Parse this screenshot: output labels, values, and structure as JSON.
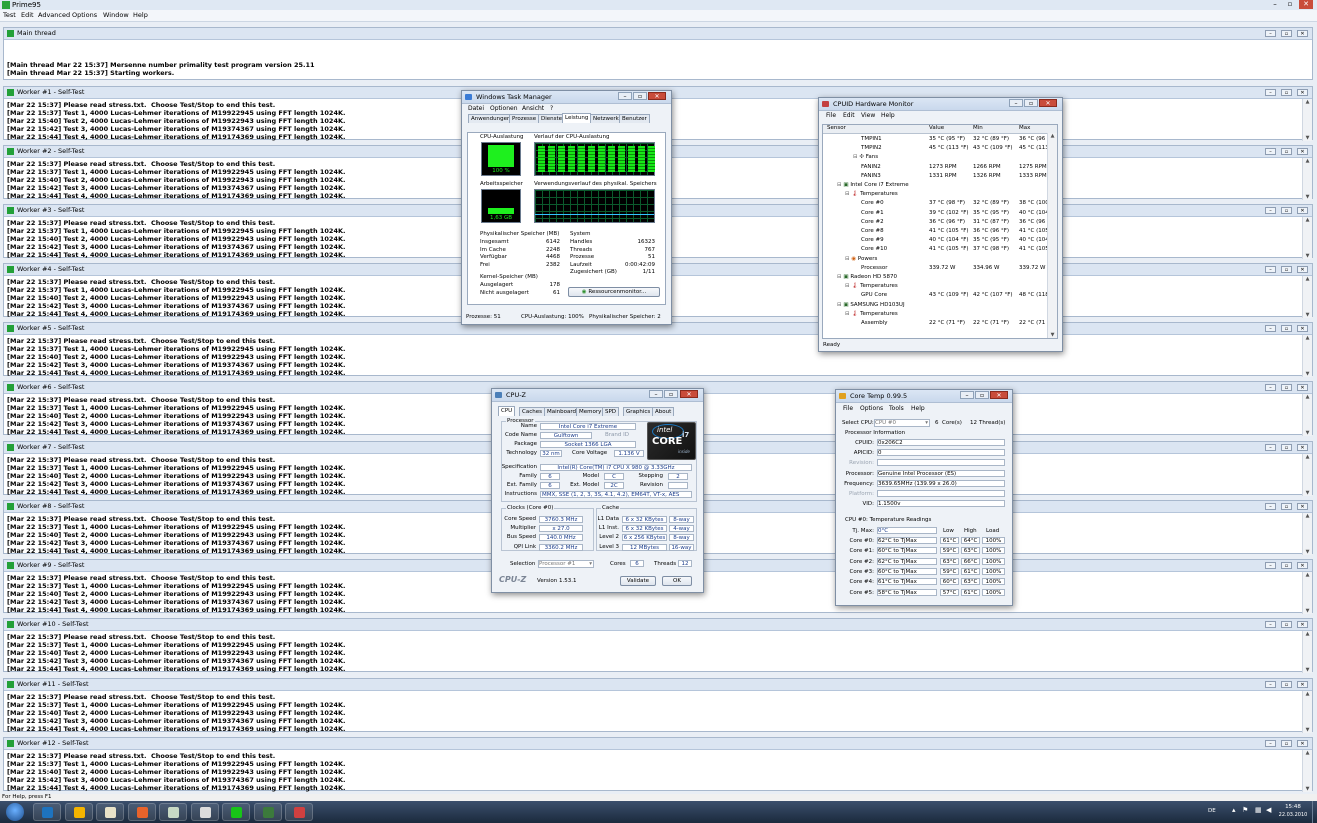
{
  "app": {
    "title": "Prime95",
    "menu": [
      "Test",
      "Edit",
      "Advanced",
      "Options",
      "Window",
      "Help"
    ],
    "status": "For Help, press F1"
  },
  "main_thread": {
    "title": "Main thread",
    "lines": [
      "[Main thread Mar 22 15:37] Mersenne number primality test program version 25.11",
      "[Main thread Mar 22 15:37] Starting workers."
    ]
  },
  "workers": [
    {
      "title": "Worker #1 - Self-Test"
    },
    {
      "title": "Worker #2 - Self-Test"
    },
    {
      "title": "Worker #3 - Self-Test"
    },
    {
      "title": "Worker #4 - Self-Test"
    },
    {
      "title": "Worker #5 - Self-Test"
    },
    {
      "title": "Worker #6 - Self-Test"
    },
    {
      "title": "Worker #7 - Self-Test"
    },
    {
      "title": "Worker #8 - Self-Test"
    },
    {
      "title": "Worker #9 - Self-Test"
    },
    {
      "title": "Worker #10 - Self-Test"
    },
    {
      "title": "Worker #11 - Self-Test"
    },
    {
      "title": "Worker #12 - Self-Test"
    }
  ],
  "worker_lines": [
    "[Mar 22 15:37] Please read stress.txt.  Choose Test/Stop to end this test.",
    "[Mar 22 15:37] Test 1, 4000 Lucas-Lehmer iterations of M19922945 using FFT length 1024K.",
    "[Mar 22 15:40] Test 2, 4000 Lucas-Lehmer iterations of M19922943 using FFT length 1024K.",
    "[Mar 22 15:42] Test 3, 4000 Lucas-Lehmer iterations of M19374367 using FFT length 1024K.",
    "[Mar 22 15:44] Test 4, 4000 Lucas-Lehmer iterations of M19174369 using FFT length 1024K."
  ],
  "taskmgr": {
    "title": "Windows Task Manager",
    "menu": [
      "Datei",
      "Optionen",
      "Ansicht",
      "?"
    ],
    "tabs": [
      "Anwendungen",
      "Prozesse",
      "Dienste",
      "Leistung",
      "Netzwerk",
      "Benutzer"
    ],
    "cpu_label": "CPU-Auslastung",
    "cpu_value": "100 %",
    "cpu_history_label": "Verlauf der CPU-Auslastung",
    "mem_label": "Arbeitsspeicher",
    "mem_value": "1,63 GB",
    "mem_history_label": "Verwendungsverlauf des physikal. Speichers",
    "phys_title": "Physikalischer Speicher (MB)",
    "phys": [
      [
        "Insgesamt",
        "6142"
      ],
      [
        "Im Cache",
        "2248"
      ],
      [
        "Verfügbar",
        "4468"
      ],
      [
        "Frei",
        "2382"
      ]
    ],
    "kernel_title": "Kernel-Speicher (MB)",
    "kernel": [
      [
        "Ausgelagert",
        "178"
      ],
      [
        "Nicht ausgelagert",
        "61"
      ]
    ],
    "system_title": "System",
    "system": [
      [
        "Handles",
        "16323"
      ],
      [
        "Threads",
        "767"
      ],
      [
        "Prozesse",
        "51"
      ],
      [
        "Laufzeit",
        "0:00:42:09"
      ],
      [
        "Zugesichert (GB)",
        "1/11"
      ]
    ],
    "resmon_button": "Ressourcenmonitor...",
    "status": [
      "Prozesse: 51",
      "CPU-Auslastung: 100%",
      "Physikalischer Speicher: 2"
    ],
    "cpu_usage_fraction": 1.0
  },
  "cpuid": {
    "title": "CPUID Hardware Monitor",
    "menu": [
      "File",
      "Edit",
      "View",
      "Help"
    ],
    "columns": [
      "Sensor",
      "Value",
      "Min",
      "Max"
    ],
    "rows": [
      {
        "indent": 4,
        "name": "TMPIN1",
        "value": "35 °C (95 °F)",
        "min": "32 °C (89 °F)",
        "max": "36 °C (96 °F"
      },
      {
        "indent": 4,
        "name": "TMPIN2",
        "value": "45 °C (113 °F)",
        "min": "43 °C (109 °F)",
        "max": "45 °C (113 °"
      },
      {
        "indent": 3,
        "name": "Fans",
        "value": "",
        "min": "",
        "max": ""
      },
      {
        "indent": 4,
        "name": "FANIN2",
        "value": "1273 RPM",
        "min": "1266 RPM",
        "max": "1275 RPM"
      },
      {
        "indent": 4,
        "name": "FANIN3",
        "value": "1331 RPM",
        "min": "1326 RPM",
        "max": "1333 RPM"
      },
      {
        "indent": 1,
        "name": "Intel Core i7 Extreme",
        "value": "",
        "min": "",
        "max": ""
      },
      {
        "indent": 2,
        "name": "Temperatures",
        "value": "",
        "min": "",
        "max": ""
      },
      {
        "indent": 4,
        "name": "Core #0",
        "value": "37 °C (98 °F)",
        "min": "32 °C (89 °F)",
        "max": "38 °C (100 °"
      },
      {
        "indent": 4,
        "name": "Core #1",
        "value": "39 °C (102 °F)",
        "min": "35 °C (95 °F)",
        "max": "40 °C (104 °"
      },
      {
        "indent": 4,
        "name": "Core #2",
        "value": "36 °C (96 °F)",
        "min": "31 °C (87 °F)",
        "max": "36 °C (96 °F"
      },
      {
        "indent": 4,
        "name": "Core #8",
        "value": "41 °C (105 °F)",
        "min": "36 °C (96 °F)",
        "max": "41 °C (105 °"
      },
      {
        "indent": 4,
        "name": "Core #9",
        "value": "40 °C (104 °F)",
        "min": "35 °C (95 °F)",
        "max": "40 °C (104 °"
      },
      {
        "indent": 4,
        "name": "Core #10",
        "value": "41 °C (105 °F)",
        "min": "37 °C (98 °F)",
        "max": "41 °C (105 °"
      },
      {
        "indent": 2,
        "name": "Powers",
        "value": "",
        "min": "",
        "max": ""
      },
      {
        "indent": 4,
        "name": "Processor",
        "value": "339.72 W",
        "min": "334.96 W",
        "max": "339.72 W"
      },
      {
        "indent": 1,
        "name": "Radeon HD 5870",
        "value": "",
        "min": "",
        "max": ""
      },
      {
        "indent": 2,
        "name": "Temperatures",
        "value": "",
        "min": "",
        "max": ""
      },
      {
        "indent": 4,
        "name": "GPU Core",
        "value": "43 °C (109 °F)",
        "min": "42 °C (107 °F)",
        "max": "48 °C (118 °"
      },
      {
        "indent": 1,
        "name": "SAMSUNG HD103UJ",
        "value": "",
        "min": "",
        "max": ""
      },
      {
        "indent": 2,
        "name": "Temperatures",
        "value": "",
        "min": "",
        "max": ""
      },
      {
        "indent": 4,
        "name": "Assembly",
        "value": "22 °C (71 °F)",
        "min": "22 °C (71 °F)",
        "max": "22 °C (71 °"
      }
    ],
    "status": "Ready"
  },
  "cpuz": {
    "title": "CPU-Z",
    "tabs": [
      "CPU",
      "Caches",
      "Mainboard",
      "Memory",
      "SPD",
      "Graphics",
      "About"
    ],
    "processor_group": "Processor",
    "name_label": "Name",
    "name": "Intel Core i7 Extreme",
    "codename_label": "Code Name",
    "codename": "Gulftown",
    "brandid_label": "Brand ID",
    "package_label": "Package",
    "package": "Socket 1366 LGA",
    "technology_label": "Technology",
    "technology": "32 nm",
    "corevoltage_label": "Core Voltage",
    "corevoltage": "1.136 V",
    "spec_label": "Specification",
    "spec": "Intel(R) Core(TM) i7 CPU    X 980  @ 3.33GHz",
    "family_label": "Family",
    "family": "6",
    "model_label": "Model",
    "model": "C",
    "stepping_label": "Stepping",
    "stepping": "2",
    "extfamily_label": "Ext. Family",
    "extfamily": "6",
    "extmodel_label": "Ext. Model",
    "extmodel": "2C",
    "revision_label": "Revision",
    "revision": "",
    "instructions_label": "Instructions",
    "instructions": "MMX, SSE (1, 2, 3, 3S, 4.1, 4.2), EM64T, VT-x, AES",
    "clocks_group": "Clocks (Core #0)",
    "clocks": [
      [
        "Core Speed",
        "3760.3 MHz"
      ],
      [
        "Multiplier",
        "x 27.0"
      ],
      [
        "Bus Speed",
        "140.0 MHz"
      ],
      [
        "QPI Link",
        "3360.2 MHz"
      ]
    ],
    "cache_group": "Cache",
    "cache": [
      [
        "L1 Data",
        "6 x 32 KBytes",
        "8-way"
      ],
      [
        "L1 Inst.",
        "6 x 32 KBytes",
        "4-way"
      ],
      [
        "Level 2",
        "6 x 256 KBytes",
        "8-way"
      ],
      [
        "Level 3",
        "12 MBytes",
        "16-way"
      ]
    ],
    "selection_label": "Selection",
    "selection": "Processor #1",
    "cores_label": "Cores",
    "cores": "6",
    "threads_label": "Threads",
    "threads": "12",
    "logo": "CPU-Z",
    "version": "Version 1.53.1",
    "validate": "Validate",
    "ok": "OK",
    "intel_logo": {
      "brand": "intel",
      "line": "CORE",
      "suffix": "i7",
      "tag": "inside"
    }
  },
  "coretemp": {
    "title": "Core Temp 0.99.5",
    "menu": [
      "File",
      "Options",
      "Tools",
      "Help"
    ],
    "select_cpu_label": "Select CPU:",
    "select_cpu": "CPU #0",
    "cores_count": "6",
    "cores_label": "Core(s)",
    "threads_count": "12",
    "threads_label": "Thread(s)",
    "info_title": "Processor Information",
    "info": [
      [
        "CPUID:",
        "0x206C2"
      ],
      [
        "APICID:",
        "0"
      ],
      [
        "Revision:",
        ""
      ],
      [
        "Processor:",
        "Genuine Intel Processor (ES)"
      ],
      [
        "Frequency:",
        "3639.65MHz (139.99 x 26.0)"
      ],
      [
        "Platform:",
        ""
      ],
      [
        "VID:",
        "1.1500v"
      ]
    ],
    "readings_title": "CPU #0: Temperature Readings",
    "tjmax_label": "Tj. Max:",
    "tjmax": "0°C",
    "col_low": "Low",
    "col_high": "High",
    "col_load": "Load",
    "cores": [
      [
        "Core #0:",
        "62°C to TjMax",
        "61°C",
        "64°C",
        "100%"
      ],
      [
        "Core #1:",
        "60°C to TjMax",
        "59°C",
        "63°C",
        "100%"
      ],
      [
        "Core #2:",
        "62°C to TjMax",
        "63°C",
        "66°C",
        "100%"
      ],
      [
        "Core #3:",
        "60°C to TjMax",
        "59°C",
        "61°C",
        "100%"
      ],
      [
        "Core #4:",
        "61°C to TjMax",
        "60°C",
        "63°C",
        "100%"
      ],
      [
        "Core #5:",
        "58°C to TjMax",
        "57°C",
        "61°C",
        "100%"
      ]
    ]
  },
  "taskbar": {
    "clock_time": "15:48",
    "clock_date": "22.03.2010",
    "lang": "DE",
    "items": [
      "start-orb",
      "internet-explorer",
      "media-player",
      "file-explorer",
      "firefox",
      "app-icon-a",
      "app-icon-b",
      "prime95",
      "cpuid",
      "coretemp"
    ]
  },
  "colors": {
    "accent": "#1ef01e",
    "worker_icon": "#23a038"
  }
}
